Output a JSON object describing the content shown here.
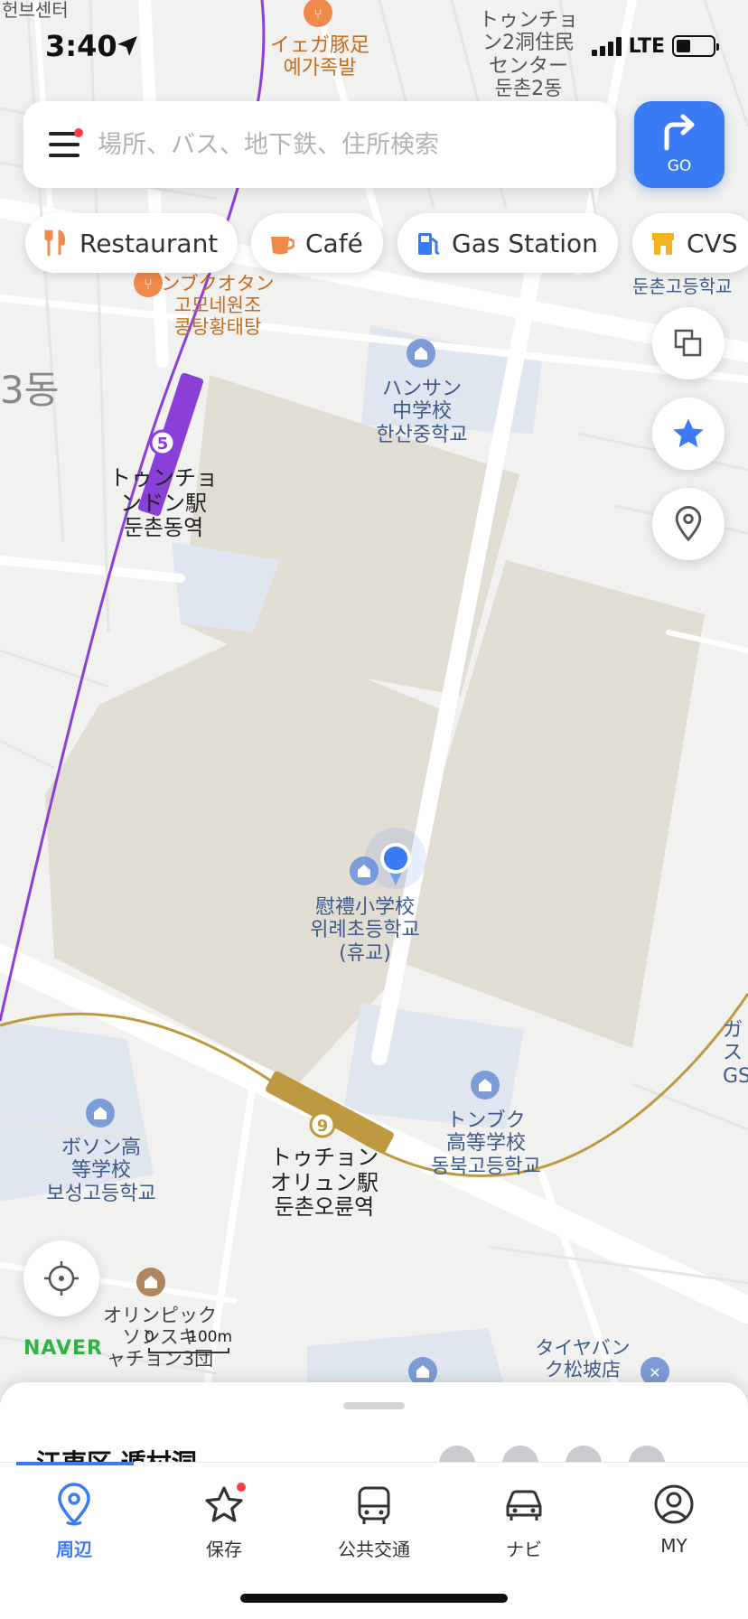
{
  "status_bar": {
    "time": "3:40",
    "network": "LTE",
    "icons": [
      "location-arrow-icon",
      "signal-icon",
      "battery-icon"
    ]
  },
  "search": {
    "placeholder": "場所、バス、地下鉄、住所検索",
    "go_label": "GO"
  },
  "chips": [
    {
      "label": "Restaurant",
      "icon": "fork-knife-icon",
      "color": "#f08a4b"
    },
    {
      "label": "Café",
      "icon": "coffee-cup-icon",
      "color": "#f08a4b"
    },
    {
      "label": "Gas Station",
      "icon": "fuel-pump-icon",
      "color": "#3b7af5"
    },
    {
      "label": "CVS",
      "icon": "store-icon",
      "color": "#f5b41e"
    }
  ],
  "map_labels": {
    "top_left_edge": "헌브센터",
    "restaurant_top": "イェガ豚足\n예가족발",
    "community_center": "トゥンチョ\nン2洞住民\nセンター\n둔촌2동",
    "high_school_right": "둔촌고등학교",
    "restaurant_mid": "ンブクオタン\n고모네원조\n콩탕황태탕",
    "district": "3동",
    "middle_school": "ハンサン\n中学校\n한산중학교",
    "station_5": "トゥンチョ\nンドン駅\n둔촌동역",
    "line_5_number": "5",
    "elementary_school": "慰禮小学校\n위례초등학교\n(휴교)",
    "station_9": "トゥチョン\nオリュン駅\n둔촌오륜역",
    "line_9_number": "9",
    "dongbuk_high": "トンブク\n高等学校\n동북고등학교",
    "boseong_high": "ボソン高\n等学校\n보성고등학교",
    "right_edge": "ガ\nス\nGS",
    "olympic": "オリンピック\nソンスキ\nャチョン3団",
    "tire_shop": "タイヤバン\nク松坡店"
  },
  "map_attribution": {
    "brand": "NAVER",
    "scale_zero": "0",
    "scale_label": "100m"
  },
  "bottom_sheet": {
    "place_name": "江東区 遁村洞"
  },
  "tabs": [
    {
      "label": "周辺",
      "icon": "location-pin-icon",
      "active": true
    },
    {
      "label": "保存",
      "icon": "star-icon",
      "active": false,
      "badge": true
    },
    {
      "label": "公共交通",
      "icon": "bus-icon",
      "active": false
    },
    {
      "label": "ナビ",
      "icon": "car-icon",
      "active": false
    },
    {
      "label": "MY",
      "icon": "user-icon",
      "active": false
    }
  ],
  "colors": {
    "accent": "#3b7af5",
    "line5": "#8b3fd9",
    "line9": "#bd9a3f",
    "poi_orange": "#d2691e",
    "poi_blue": "#3d5a8a",
    "naver_green": "#2fb344"
  }
}
